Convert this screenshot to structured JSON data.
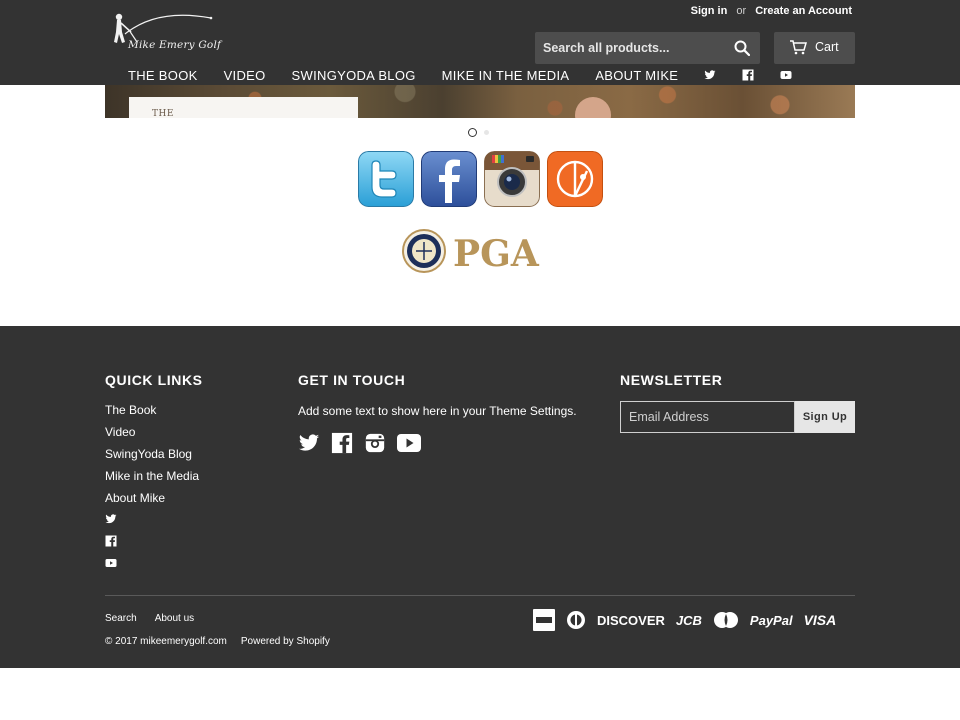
{
  "header": {
    "logo_text": "Mike Emery Golf",
    "sign_in": "Sign in",
    "or": "or",
    "create_account": "Create an Account",
    "search_placeholder": "Search all products...",
    "cart": "Cart"
  },
  "nav": {
    "items": [
      "THE BOOK",
      "VIDEO",
      "SWINGYODA BLOG",
      "MIKE IN THE MEDIA",
      "ABOUT MIKE"
    ],
    "icons": [
      "twitter-icon",
      "facebook-icon",
      "youtube-icon"
    ]
  },
  "hero": {
    "card_text": "THE"
  },
  "slider": {
    "count": 2,
    "active": 1
  },
  "social_big": [
    "twitter",
    "facebook",
    "instagram",
    "golf-app"
  ],
  "badge": {
    "text": "PGA"
  },
  "footer": {
    "quick_links_title": "QUICK LINKS",
    "quick_links": [
      "The Book",
      "Video",
      "SwingYoda Blog",
      "Mike in the Media",
      "About Mike"
    ],
    "get_in_touch_title": "GET IN TOUCH",
    "get_in_touch_text": "Add some text to show here in your Theme Settings.",
    "newsletter_title": "NEWSLETTER",
    "email_placeholder": "Email Address",
    "signup": "Sign Up",
    "search_link": "Search",
    "about_link": "About us",
    "copyright": "© 2017 mikeemerygolf.com",
    "powered": "Powered by Shopify",
    "payments": [
      "DISCOVER",
      "JCB",
      "PayPal",
      "VISA"
    ]
  },
  "colors": {
    "dark": "#333333",
    "mid": "#4d4d4d",
    "pga_gold": "#b8955a"
  }
}
